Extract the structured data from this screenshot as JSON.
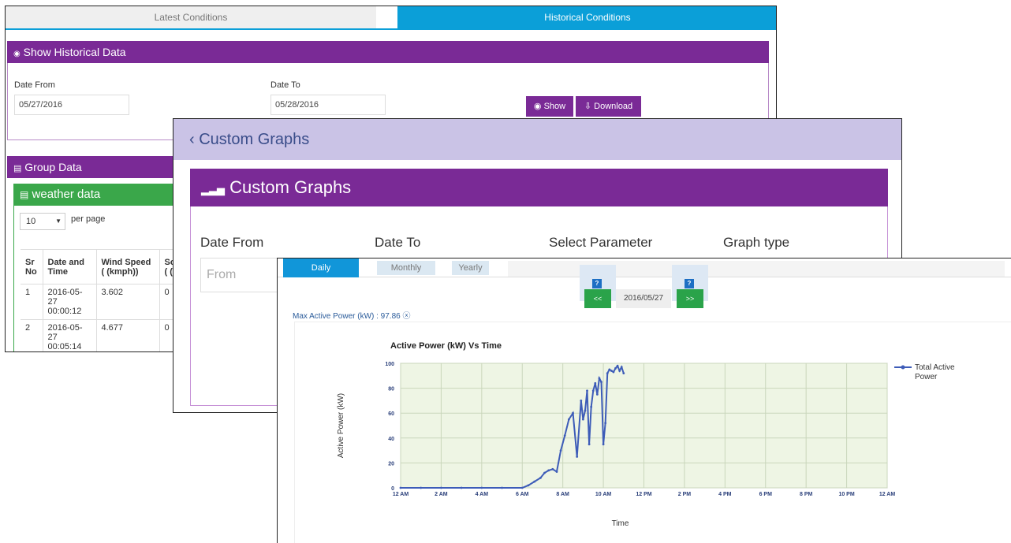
{
  "historical": {
    "tabs": {
      "latest": "Latest Conditions",
      "historical": "Historical Conditions"
    },
    "show_section": {
      "title": "Show Historical Data",
      "date_from_label": "Date From",
      "date_from_value": "05/27/2016",
      "date_to_label": "Date To",
      "date_to_value": "05/28/2016",
      "show_label": "Show",
      "download_label": "Download"
    },
    "group_section": {
      "title": "Group Data"
    },
    "weather": {
      "title": "weather data",
      "per_page_value": "10",
      "per_page_label": "per page",
      "columns": [
        "Sr No",
        "Date and Time",
        "Wind Speed ( (kmph))",
        "So ( ("
      ],
      "rows": [
        {
          "sr": "1",
          "datetime": "2016-05-27 00:00:12",
          "wind": "3.602",
          "so": "0"
        },
        {
          "sr": "2",
          "datetime": "2016-05-27 00:05:14",
          "wind": "4.677",
          "so": "0"
        }
      ]
    }
  },
  "custom_graphs": {
    "back_title": "Custom Graphs",
    "panel_title": "Custom Graphs",
    "labels": {
      "date_from": "Date From",
      "date_to": "Date To",
      "select_parameter": "Select Parameter",
      "graph_type": "Graph type"
    },
    "from_placeholder": "From"
  },
  "daily": {
    "tabs": {
      "daily": "Daily",
      "monthly": "Monthly",
      "yearly": "Yearly"
    },
    "help": "?",
    "prev": "<<",
    "next": ">>",
    "date": "2016/05/27",
    "max_label": "Max Active Power (kW) : 97.86"
  },
  "colors": {
    "purple": "#7a2a96",
    "blue": "#0b9fd8",
    "green": "#2aa34a",
    "series": "#3d5cb8"
  },
  "chart_data": {
    "type": "line",
    "title": "Active Power (kW) Vs Time",
    "xlabel": "Time",
    "ylabel": "Active Power (kW)",
    "ylim": [
      0,
      100
    ],
    "yticks": [
      0,
      20,
      40,
      60,
      80,
      100
    ],
    "xticks": [
      "12 AM",
      "2 AM",
      "4 AM",
      "6 AM",
      "8 AM",
      "10 AM",
      "12 PM",
      "2 PM",
      "4 PM",
      "6 PM",
      "8 PM",
      "10 PM",
      "12 AM"
    ],
    "grid": true,
    "legend_position": "right",
    "series": [
      {
        "name": "Total Active Power",
        "x_hours": [
          0,
          1,
          2,
          3,
          4,
          5,
          6,
          6.3,
          6.6,
          6.9,
          7.1,
          7.3,
          7.5,
          7.7,
          7.9,
          8.1,
          8.3,
          8.5,
          8.7,
          8.9,
          9.0,
          9.1,
          9.2,
          9.3,
          9.4,
          9.5,
          9.6,
          9.7,
          9.8,
          9.9,
          10.0,
          10.1,
          10.2,
          10.3,
          10.4,
          10.5,
          10.6,
          10.7,
          10.8,
          10.9,
          11.0
        ],
        "values": [
          0,
          0,
          0,
          0,
          0,
          0,
          0,
          2,
          5,
          8,
          12,
          14,
          15,
          13,
          30,
          42,
          55,
          60,
          25,
          70,
          55,
          62,
          78,
          35,
          65,
          78,
          84,
          75,
          88,
          85,
          35,
          52,
          92,
          95,
          94,
          93,
          96,
          97.9,
          94,
          97,
          92
        ]
      }
    ]
  }
}
